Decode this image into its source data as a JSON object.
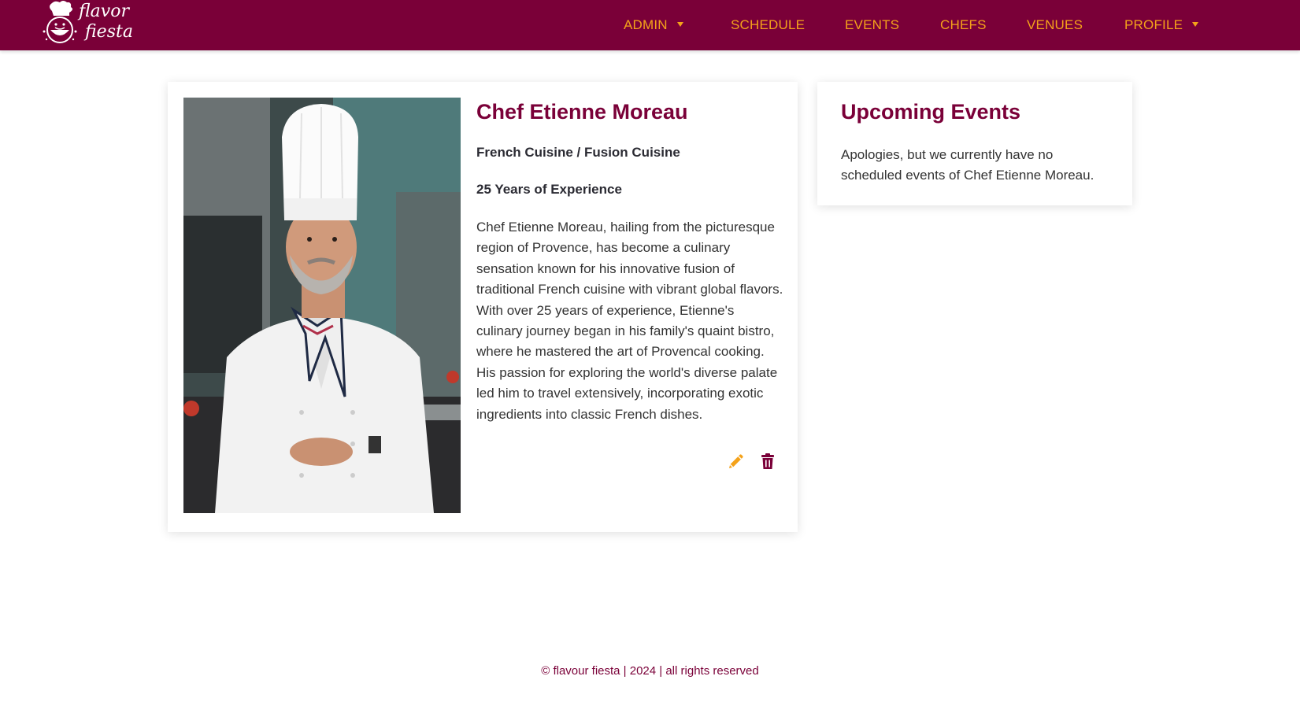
{
  "brand": {
    "logo_text_line1": "flavor",
    "logo_text_line2": "fiesta",
    "color": "#7a0038",
    "accent": "#f4a21a"
  },
  "nav": {
    "admin": "ADMIN",
    "schedule": "SCHEDULE",
    "events": "EVENTS",
    "chefs": "CHEFS",
    "venues": "VENUES",
    "profile": "PROFILE"
  },
  "chef": {
    "name": "Chef Etienne Moreau",
    "cuisine": "French Cuisine / Fusion Cuisine",
    "experience": "25 Years of Experience",
    "bio": "Chef Etienne Moreau, hailing from the picturesque region of Provence, has become a culinary sensation known for his innovative fusion of traditional French cuisine with vibrant global flavors. With over 25 years of experience, Etienne's culinary journey began in his family's quaint bistro, where he mastered the art of Provencal cooking. His passion for exploring the world's diverse palate led him to travel extensively, incorporating exotic ingredients into classic French dishes.",
    "actions": {
      "edit_icon": "pencil-icon",
      "delete_icon": "trash-icon"
    }
  },
  "events": {
    "title": "Upcoming Events",
    "empty_message": "Apologies, but we currently have no scheduled events of Chef Etienne Moreau."
  },
  "footer": {
    "text": "© flavour fiesta | 2024 | all rights reserved"
  }
}
